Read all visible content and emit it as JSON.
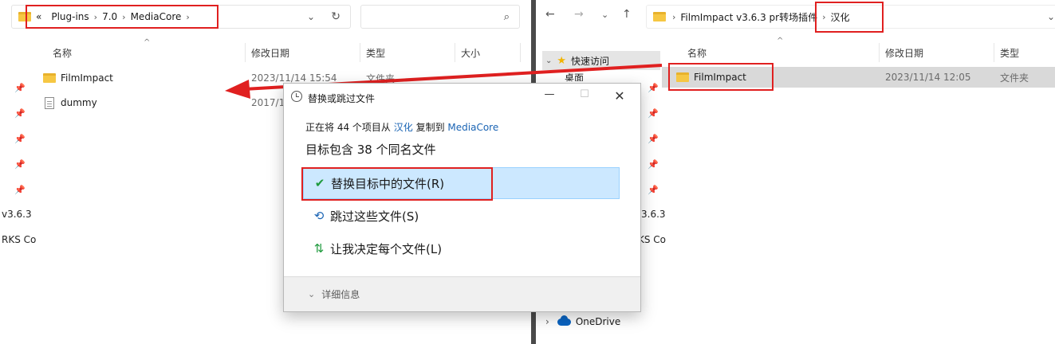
{
  "left": {
    "breadcrumb": [
      "«",
      "Plug-ins",
      "7.0",
      "MediaCore"
    ],
    "columns": [
      "名称",
      "修改日期",
      "类型",
      "大小"
    ],
    "rows": [
      {
        "name": "FilmImpact",
        "date": "2023/11/14 15:54",
        "type": "文件夹",
        "kind": "folder"
      },
      {
        "name": "dummy",
        "date": "2017/1",
        "type": "",
        "kind": "file"
      }
    ],
    "cut_labels": [
      "v3.6.3",
      "RKS Co"
    ]
  },
  "right": {
    "breadcrumb": [
      "FilmImpact v3.6.3 pr转场插件",
      "汉化"
    ],
    "columns": [
      "名称",
      "修改日期",
      "类型"
    ],
    "rows": [
      {
        "name": "FilmImpact",
        "date": "2023/11/14 12:05",
        "type": "文件夹",
        "kind": "folder",
        "selected": true
      }
    ],
    "sidebar": {
      "quick_access": "快速访问",
      "desktop_cut": "桌面",
      "cut_labels": [
        "3.6.3",
        "KS Co"
      ],
      "onedrive": "OneDrive"
    }
  },
  "dialog": {
    "title": "替换或跳过文件",
    "copy_prefix": "正在将 44 个项目从",
    "source": "汉化",
    "copy_mid": "复制到",
    "dest": "MediaCore",
    "heading": "目标包含 38 个同名文件",
    "options": [
      {
        "label": "替换目标中的文件(R)",
        "icon": "check-icon"
      },
      {
        "label": "跳过这些文件(S)",
        "icon": "skip-icon"
      },
      {
        "label": "让我决定每个文件(L)",
        "icon": "decide-icon"
      }
    ],
    "details": "详细信息"
  },
  "colors": {
    "annotation_red": "#e02020",
    "highlight": "#cce8ff",
    "link": "#1a64b4",
    "folder": "#f6c743"
  }
}
